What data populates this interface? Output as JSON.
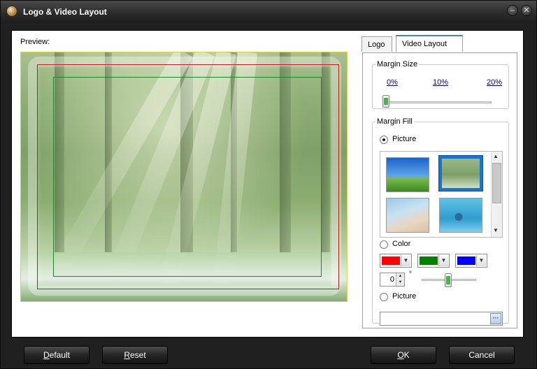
{
  "window": {
    "title": "Logo & Video Layout",
    "minimize_glyph": "–",
    "close_glyph": "✕"
  },
  "preview": {
    "label": "Preview:"
  },
  "tabs": [
    {
      "label": "Logo",
      "selected": false
    },
    {
      "label": "Video Layout",
      "selected": true
    }
  ],
  "margin_size": {
    "legend": "Margin Size",
    "ticks": [
      "0%",
      "10%",
      "20%"
    ],
    "value": "0%"
  },
  "margin_fill": {
    "legend": "Margin Fill",
    "picture_option": {
      "label": "Picture",
      "selected": true
    },
    "thumbnails": [
      "green-hill-landscape",
      "forest-light-rays",
      "beach-shore",
      "underwater-palm"
    ],
    "selected_thumbnail": "forest-light-rays",
    "color_option": {
      "label": "Color",
      "selected": false
    },
    "colors": [
      "#ff0000",
      "#008000",
      "#0000ff"
    ],
    "angle_value": "0",
    "angle_unit": "°",
    "picture_option_2": {
      "label": "Picture",
      "selected": false
    },
    "browse_label": "···"
  },
  "buttons": {
    "default": {
      "mnemonic": "D",
      "rest": "efault"
    },
    "reset": {
      "mnemonic": "R",
      "rest": "eset"
    },
    "ok": {
      "mnemonic": "O",
      "rest": "K"
    },
    "cancel": {
      "label": "Cancel"
    }
  },
  "colors": {
    "tab_accent": "#3d86c6",
    "outer_margin": "#d01818",
    "inner_margin": "#178a2a",
    "selection": "#1874cd"
  }
}
